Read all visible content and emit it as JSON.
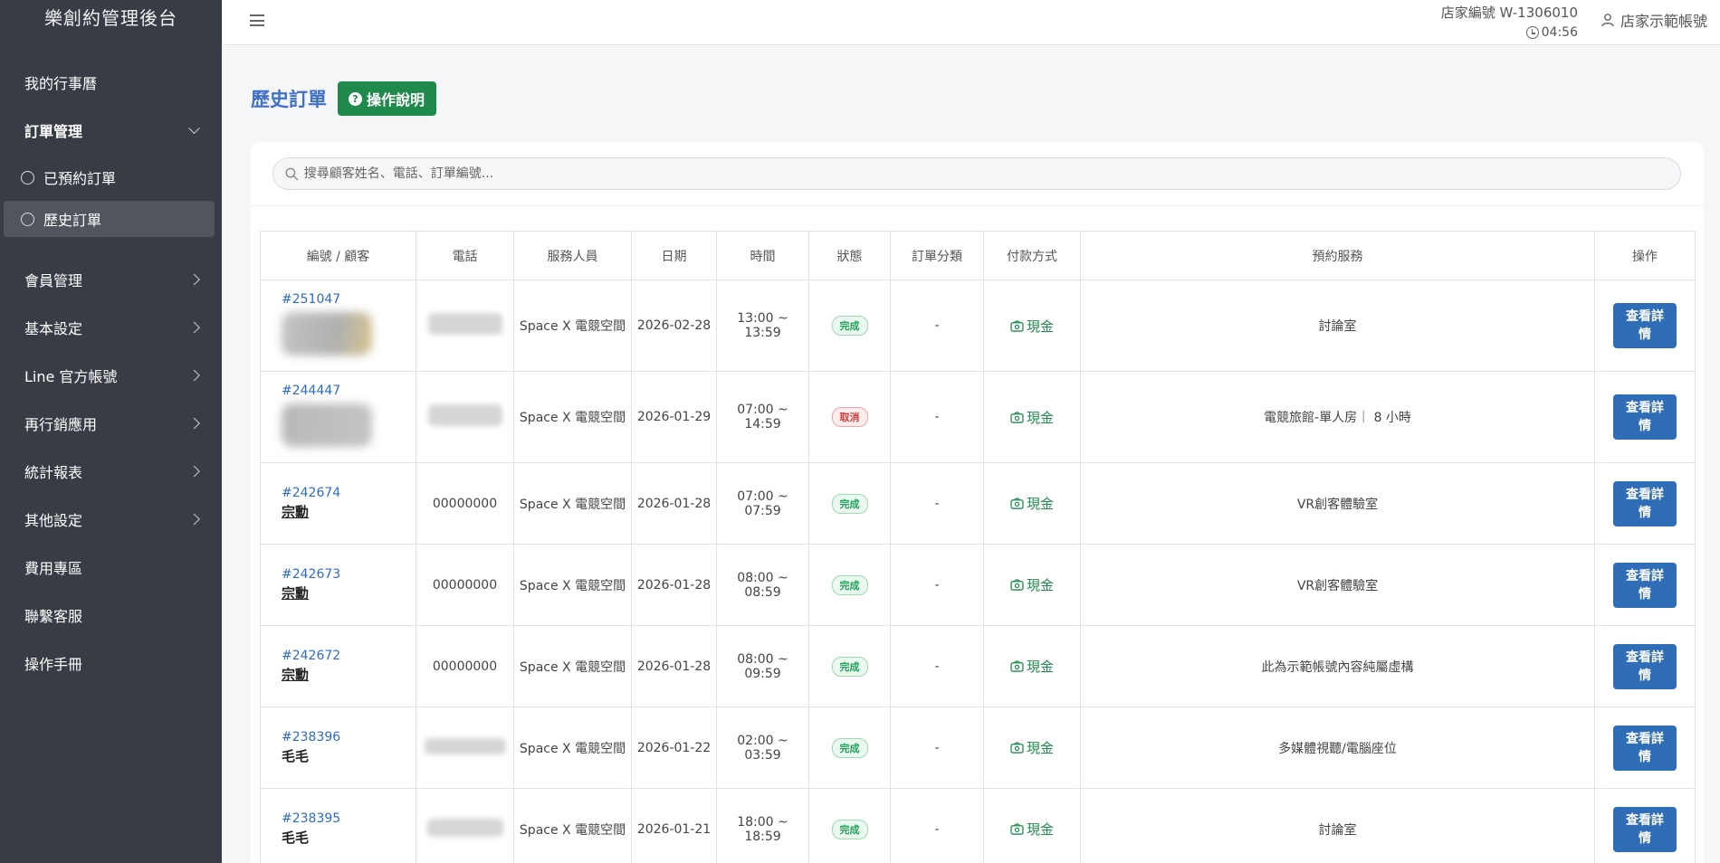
{
  "app": {
    "title": "樂創約管理後台"
  },
  "sidebar": {
    "items": [
      {
        "label": "我的行事曆"
      },
      {
        "label": "訂單管理"
      },
      {
        "label": "已預約訂單"
      },
      {
        "label": "歷史訂單"
      },
      {
        "label": "會員管理"
      },
      {
        "label": "基本設定"
      },
      {
        "label": "Line 官方帳號"
      },
      {
        "label": "再行銷應用"
      },
      {
        "label": "統計報表"
      },
      {
        "label": "其他設定"
      },
      {
        "label": "費用專區"
      },
      {
        "label": "聯繫客服"
      },
      {
        "label": "操作手冊"
      }
    ]
  },
  "header": {
    "shop_id": "店家編號 W-1306010",
    "time": "04:56",
    "account": "店家示範帳號"
  },
  "page": {
    "title": "歷史訂單",
    "help_label": "操作說明"
  },
  "search": {
    "placeholder": "搜尋顧客姓名、電話、訂單編號..."
  },
  "table": {
    "headers": [
      "編號 / 顧客",
      "電話",
      "服務人員",
      "日期",
      "時間",
      "狀態",
      "訂單分類",
      "付款方式",
      "預約服務",
      "操作"
    ],
    "rows": [
      {
        "order_no": "#251047",
        "customer": "",
        "phone": "",
        "staff": "Space X 電競空間",
        "date": "2026-02-28",
        "time": "13:00 ~ 13:59",
        "status": "完成",
        "category": "-",
        "payment": "現金",
        "service": "討論室",
        "action": "查看詳情"
      },
      {
        "order_no": "#244447",
        "customer": "",
        "phone": "",
        "staff": "Space X 電競空間",
        "date": "2026-01-29",
        "time": "07:00 ~ 14:59",
        "status": "取消",
        "category": "-",
        "payment": "現金",
        "service": "電競旅館-單人房｜ 8 小時",
        "action": "查看詳情"
      },
      {
        "order_no": "#242674",
        "customer": "宗勳",
        "phone": "00000000",
        "staff": "Space X 電競空間",
        "date": "2026-01-28",
        "time": "07:00 ~ 07:59",
        "status": "完成",
        "category": "-",
        "payment": "現金",
        "service": "VR創客體驗室",
        "action": "查看詳情"
      },
      {
        "order_no": "#242673",
        "customer": "宗勳",
        "phone": "00000000",
        "staff": "Space X 電競空間",
        "date": "2026-01-28",
        "time": "08:00 ~ 08:59",
        "status": "完成",
        "category": "-",
        "payment": "現金",
        "service": "VR創客體驗室",
        "action": "查看詳情"
      },
      {
        "order_no": "#242672",
        "customer": "宗勳",
        "phone": "00000000",
        "staff": "Space X 電競空間",
        "date": "2026-01-28",
        "time": "08:00 ~ 09:59",
        "status": "完成",
        "category": "-",
        "payment": "現金",
        "service": "此為示範帳號內容純屬虛構",
        "action": "查看詳情"
      },
      {
        "order_no": "#238396",
        "customer": "毛毛",
        "phone": "",
        "staff": "Space X 電競空間",
        "date": "2026-01-22",
        "time": "02:00 ~ 03:59",
        "status": "完成",
        "category": "-",
        "payment": "現金",
        "service": "多媒體視聽/電腦座位",
        "action": "查看詳情"
      },
      {
        "order_no": "#238395",
        "customer": "毛毛",
        "phone": "",
        "staff": "Space X 電競空間",
        "date": "2026-01-21",
        "time": "18:00 ~ 18:59",
        "status": "完成",
        "category": "-",
        "payment": "現金",
        "service": "討論室",
        "action": "查看詳情"
      }
    ]
  },
  "colors": {
    "sidebar_bg": "#383c44",
    "accent_blue": "#2f6db6",
    "accent_green": "#1f8a4c",
    "status_done": "#22a35a",
    "status_cancel": "#d23b3b"
  }
}
